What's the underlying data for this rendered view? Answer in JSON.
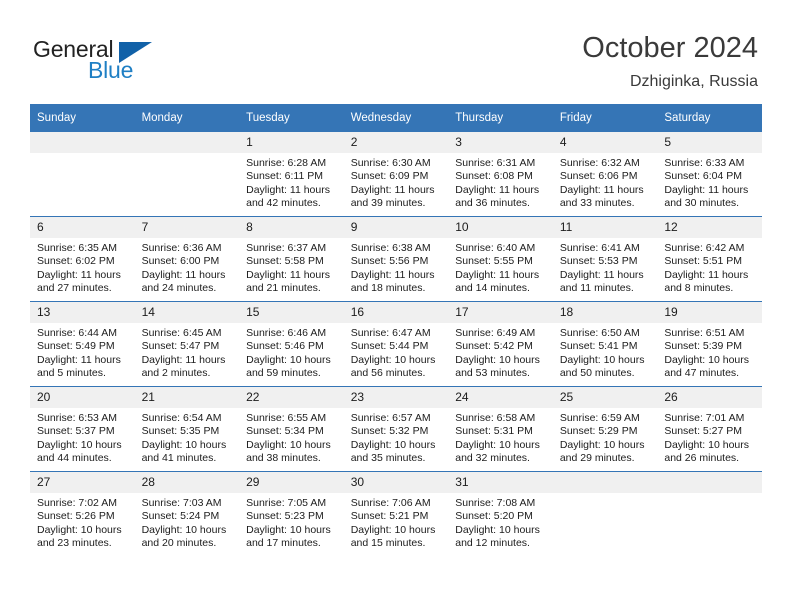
{
  "brand": {
    "name_part1": "General",
    "name_part2": "Blue",
    "logo_icon": "triangle-icon",
    "accent_color": "#1161a8",
    "text_color": "#1f7fc4"
  },
  "header": {
    "title": "October 2024",
    "subtitle": "Dzhiginka, Russia"
  },
  "colors": {
    "header_row_bg": "#3575b6",
    "header_row_text": "#ffffff",
    "daynum_bg": "#f0f0f0",
    "cell_bg": "#ffffff",
    "grid_line": "#3575b6"
  },
  "weekdays": [
    "Sunday",
    "Monday",
    "Tuesday",
    "Wednesday",
    "Thursday",
    "Friday",
    "Saturday"
  ],
  "weeks": [
    [
      {
        "day": "",
        "sunrise": "",
        "sunset": "",
        "daylight_line1": "",
        "daylight_line2": ""
      },
      {
        "day": "",
        "sunrise": "",
        "sunset": "",
        "daylight_line1": "",
        "daylight_line2": ""
      },
      {
        "day": "1",
        "sunrise": "Sunrise: 6:28 AM",
        "sunset": "Sunset: 6:11 PM",
        "daylight_line1": "Daylight: 11 hours",
        "daylight_line2": "and 42 minutes."
      },
      {
        "day": "2",
        "sunrise": "Sunrise: 6:30 AM",
        "sunset": "Sunset: 6:09 PM",
        "daylight_line1": "Daylight: 11 hours",
        "daylight_line2": "and 39 minutes."
      },
      {
        "day": "3",
        "sunrise": "Sunrise: 6:31 AM",
        "sunset": "Sunset: 6:08 PM",
        "daylight_line1": "Daylight: 11 hours",
        "daylight_line2": "and 36 minutes."
      },
      {
        "day": "4",
        "sunrise": "Sunrise: 6:32 AM",
        "sunset": "Sunset: 6:06 PM",
        "daylight_line1": "Daylight: 11 hours",
        "daylight_line2": "and 33 minutes."
      },
      {
        "day": "5",
        "sunrise": "Sunrise: 6:33 AM",
        "sunset": "Sunset: 6:04 PM",
        "daylight_line1": "Daylight: 11 hours",
        "daylight_line2": "and 30 minutes."
      }
    ],
    [
      {
        "day": "6",
        "sunrise": "Sunrise: 6:35 AM",
        "sunset": "Sunset: 6:02 PM",
        "daylight_line1": "Daylight: 11 hours",
        "daylight_line2": "and 27 minutes."
      },
      {
        "day": "7",
        "sunrise": "Sunrise: 6:36 AM",
        "sunset": "Sunset: 6:00 PM",
        "daylight_line1": "Daylight: 11 hours",
        "daylight_line2": "and 24 minutes."
      },
      {
        "day": "8",
        "sunrise": "Sunrise: 6:37 AM",
        "sunset": "Sunset: 5:58 PM",
        "daylight_line1": "Daylight: 11 hours",
        "daylight_line2": "and 21 minutes."
      },
      {
        "day": "9",
        "sunrise": "Sunrise: 6:38 AM",
        "sunset": "Sunset: 5:56 PM",
        "daylight_line1": "Daylight: 11 hours",
        "daylight_line2": "and 18 minutes."
      },
      {
        "day": "10",
        "sunrise": "Sunrise: 6:40 AM",
        "sunset": "Sunset: 5:55 PM",
        "daylight_line1": "Daylight: 11 hours",
        "daylight_line2": "and 14 minutes."
      },
      {
        "day": "11",
        "sunrise": "Sunrise: 6:41 AM",
        "sunset": "Sunset: 5:53 PM",
        "daylight_line1": "Daylight: 11 hours",
        "daylight_line2": "and 11 minutes."
      },
      {
        "day": "12",
        "sunrise": "Sunrise: 6:42 AM",
        "sunset": "Sunset: 5:51 PM",
        "daylight_line1": "Daylight: 11 hours",
        "daylight_line2": "and 8 minutes."
      }
    ],
    [
      {
        "day": "13",
        "sunrise": "Sunrise: 6:44 AM",
        "sunset": "Sunset: 5:49 PM",
        "daylight_line1": "Daylight: 11 hours",
        "daylight_line2": "and 5 minutes."
      },
      {
        "day": "14",
        "sunrise": "Sunrise: 6:45 AM",
        "sunset": "Sunset: 5:47 PM",
        "daylight_line1": "Daylight: 11 hours",
        "daylight_line2": "and 2 minutes."
      },
      {
        "day": "15",
        "sunrise": "Sunrise: 6:46 AM",
        "sunset": "Sunset: 5:46 PM",
        "daylight_line1": "Daylight: 10 hours",
        "daylight_line2": "and 59 minutes."
      },
      {
        "day": "16",
        "sunrise": "Sunrise: 6:47 AM",
        "sunset": "Sunset: 5:44 PM",
        "daylight_line1": "Daylight: 10 hours",
        "daylight_line2": "and 56 minutes."
      },
      {
        "day": "17",
        "sunrise": "Sunrise: 6:49 AM",
        "sunset": "Sunset: 5:42 PM",
        "daylight_line1": "Daylight: 10 hours",
        "daylight_line2": "and 53 minutes."
      },
      {
        "day": "18",
        "sunrise": "Sunrise: 6:50 AM",
        "sunset": "Sunset: 5:41 PM",
        "daylight_line1": "Daylight: 10 hours",
        "daylight_line2": "and 50 minutes."
      },
      {
        "day": "19",
        "sunrise": "Sunrise: 6:51 AM",
        "sunset": "Sunset: 5:39 PM",
        "daylight_line1": "Daylight: 10 hours",
        "daylight_line2": "and 47 minutes."
      }
    ],
    [
      {
        "day": "20",
        "sunrise": "Sunrise: 6:53 AM",
        "sunset": "Sunset: 5:37 PM",
        "daylight_line1": "Daylight: 10 hours",
        "daylight_line2": "and 44 minutes."
      },
      {
        "day": "21",
        "sunrise": "Sunrise: 6:54 AM",
        "sunset": "Sunset: 5:35 PM",
        "daylight_line1": "Daylight: 10 hours",
        "daylight_line2": "and 41 minutes."
      },
      {
        "day": "22",
        "sunrise": "Sunrise: 6:55 AM",
        "sunset": "Sunset: 5:34 PM",
        "daylight_line1": "Daylight: 10 hours",
        "daylight_line2": "and 38 minutes."
      },
      {
        "day": "23",
        "sunrise": "Sunrise: 6:57 AM",
        "sunset": "Sunset: 5:32 PM",
        "daylight_line1": "Daylight: 10 hours",
        "daylight_line2": "and 35 minutes."
      },
      {
        "day": "24",
        "sunrise": "Sunrise: 6:58 AM",
        "sunset": "Sunset: 5:31 PM",
        "daylight_line1": "Daylight: 10 hours",
        "daylight_line2": "and 32 minutes."
      },
      {
        "day": "25",
        "sunrise": "Sunrise: 6:59 AM",
        "sunset": "Sunset: 5:29 PM",
        "daylight_line1": "Daylight: 10 hours",
        "daylight_line2": "and 29 minutes."
      },
      {
        "day": "26",
        "sunrise": "Sunrise: 7:01 AM",
        "sunset": "Sunset: 5:27 PM",
        "daylight_line1": "Daylight: 10 hours",
        "daylight_line2": "and 26 minutes."
      }
    ],
    [
      {
        "day": "27",
        "sunrise": "Sunrise: 7:02 AM",
        "sunset": "Sunset: 5:26 PM",
        "daylight_line1": "Daylight: 10 hours",
        "daylight_line2": "and 23 minutes."
      },
      {
        "day": "28",
        "sunrise": "Sunrise: 7:03 AM",
        "sunset": "Sunset: 5:24 PM",
        "daylight_line1": "Daylight: 10 hours",
        "daylight_line2": "and 20 minutes."
      },
      {
        "day": "29",
        "sunrise": "Sunrise: 7:05 AM",
        "sunset": "Sunset: 5:23 PM",
        "daylight_line1": "Daylight: 10 hours",
        "daylight_line2": "and 17 minutes."
      },
      {
        "day": "30",
        "sunrise": "Sunrise: 7:06 AM",
        "sunset": "Sunset: 5:21 PM",
        "daylight_line1": "Daylight: 10 hours",
        "daylight_line2": "and 15 minutes."
      },
      {
        "day": "31",
        "sunrise": "Sunrise: 7:08 AM",
        "sunset": "Sunset: 5:20 PM",
        "daylight_line1": "Daylight: 10 hours",
        "daylight_line2": "and 12 minutes."
      },
      {
        "day": "",
        "sunrise": "",
        "sunset": "",
        "daylight_line1": "",
        "daylight_line2": ""
      },
      {
        "day": "",
        "sunrise": "",
        "sunset": "",
        "daylight_line1": "",
        "daylight_line2": ""
      }
    ]
  ]
}
